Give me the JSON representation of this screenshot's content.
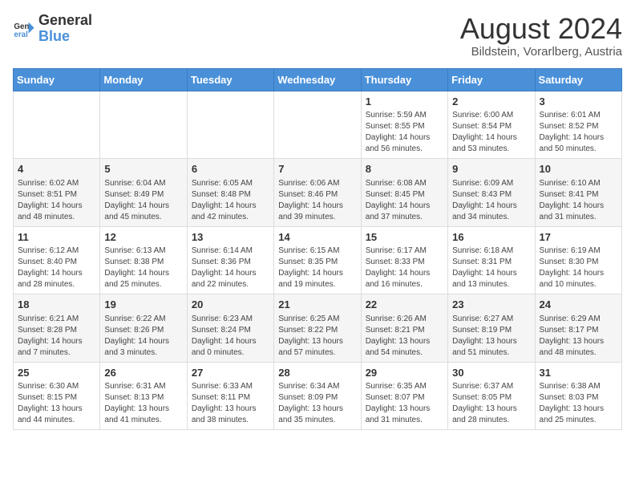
{
  "header": {
    "logo_general": "General",
    "logo_blue": "Blue",
    "main_title": "August 2024",
    "subtitle": "Bildstein, Vorarlberg, Austria"
  },
  "weekdays": [
    "Sunday",
    "Monday",
    "Tuesday",
    "Wednesday",
    "Thursday",
    "Friday",
    "Saturday"
  ],
  "weeks": [
    [
      {
        "day": "",
        "info": ""
      },
      {
        "day": "",
        "info": ""
      },
      {
        "day": "",
        "info": ""
      },
      {
        "day": "",
        "info": ""
      },
      {
        "day": "1",
        "info": "Sunrise: 5:59 AM\nSunset: 8:55 PM\nDaylight: 14 hours\nand 56 minutes."
      },
      {
        "day": "2",
        "info": "Sunrise: 6:00 AM\nSunset: 8:54 PM\nDaylight: 14 hours\nand 53 minutes."
      },
      {
        "day": "3",
        "info": "Sunrise: 6:01 AM\nSunset: 8:52 PM\nDaylight: 14 hours\nand 50 minutes."
      }
    ],
    [
      {
        "day": "4",
        "info": "Sunrise: 6:02 AM\nSunset: 8:51 PM\nDaylight: 14 hours\nand 48 minutes."
      },
      {
        "day": "5",
        "info": "Sunrise: 6:04 AM\nSunset: 8:49 PM\nDaylight: 14 hours\nand 45 minutes."
      },
      {
        "day": "6",
        "info": "Sunrise: 6:05 AM\nSunset: 8:48 PM\nDaylight: 14 hours\nand 42 minutes."
      },
      {
        "day": "7",
        "info": "Sunrise: 6:06 AM\nSunset: 8:46 PM\nDaylight: 14 hours\nand 39 minutes."
      },
      {
        "day": "8",
        "info": "Sunrise: 6:08 AM\nSunset: 8:45 PM\nDaylight: 14 hours\nand 37 minutes."
      },
      {
        "day": "9",
        "info": "Sunrise: 6:09 AM\nSunset: 8:43 PM\nDaylight: 14 hours\nand 34 minutes."
      },
      {
        "day": "10",
        "info": "Sunrise: 6:10 AM\nSunset: 8:41 PM\nDaylight: 14 hours\nand 31 minutes."
      }
    ],
    [
      {
        "day": "11",
        "info": "Sunrise: 6:12 AM\nSunset: 8:40 PM\nDaylight: 14 hours\nand 28 minutes."
      },
      {
        "day": "12",
        "info": "Sunrise: 6:13 AM\nSunset: 8:38 PM\nDaylight: 14 hours\nand 25 minutes."
      },
      {
        "day": "13",
        "info": "Sunrise: 6:14 AM\nSunset: 8:36 PM\nDaylight: 14 hours\nand 22 minutes."
      },
      {
        "day": "14",
        "info": "Sunrise: 6:15 AM\nSunset: 8:35 PM\nDaylight: 14 hours\nand 19 minutes."
      },
      {
        "day": "15",
        "info": "Sunrise: 6:17 AM\nSunset: 8:33 PM\nDaylight: 14 hours\nand 16 minutes."
      },
      {
        "day": "16",
        "info": "Sunrise: 6:18 AM\nSunset: 8:31 PM\nDaylight: 14 hours\nand 13 minutes."
      },
      {
        "day": "17",
        "info": "Sunrise: 6:19 AM\nSunset: 8:30 PM\nDaylight: 14 hours\nand 10 minutes."
      }
    ],
    [
      {
        "day": "18",
        "info": "Sunrise: 6:21 AM\nSunset: 8:28 PM\nDaylight: 14 hours\nand 7 minutes."
      },
      {
        "day": "19",
        "info": "Sunrise: 6:22 AM\nSunset: 8:26 PM\nDaylight: 14 hours\nand 3 minutes."
      },
      {
        "day": "20",
        "info": "Sunrise: 6:23 AM\nSunset: 8:24 PM\nDaylight: 14 hours\nand 0 minutes."
      },
      {
        "day": "21",
        "info": "Sunrise: 6:25 AM\nSunset: 8:22 PM\nDaylight: 13 hours\nand 57 minutes."
      },
      {
        "day": "22",
        "info": "Sunrise: 6:26 AM\nSunset: 8:21 PM\nDaylight: 13 hours\nand 54 minutes."
      },
      {
        "day": "23",
        "info": "Sunrise: 6:27 AM\nSunset: 8:19 PM\nDaylight: 13 hours\nand 51 minutes."
      },
      {
        "day": "24",
        "info": "Sunrise: 6:29 AM\nSunset: 8:17 PM\nDaylight: 13 hours\nand 48 minutes."
      }
    ],
    [
      {
        "day": "25",
        "info": "Sunrise: 6:30 AM\nSunset: 8:15 PM\nDaylight: 13 hours\nand 44 minutes."
      },
      {
        "day": "26",
        "info": "Sunrise: 6:31 AM\nSunset: 8:13 PM\nDaylight: 13 hours\nand 41 minutes."
      },
      {
        "day": "27",
        "info": "Sunrise: 6:33 AM\nSunset: 8:11 PM\nDaylight: 13 hours\nand 38 minutes."
      },
      {
        "day": "28",
        "info": "Sunrise: 6:34 AM\nSunset: 8:09 PM\nDaylight: 13 hours\nand 35 minutes."
      },
      {
        "day": "29",
        "info": "Sunrise: 6:35 AM\nSunset: 8:07 PM\nDaylight: 13 hours\nand 31 minutes."
      },
      {
        "day": "30",
        "info": "Sunrise: 6:37 AM\nSunset: 8:05 PM\nDaylight: 13 hours\nand 28 minutes."
      },
      {
        "day": "31",
        "info": "Sunrise: 6:38 AM\nSunset: 8:03 PM\nDaylight: 13 hours\nand 25 minutes."
      }
    ]
  ]
}
